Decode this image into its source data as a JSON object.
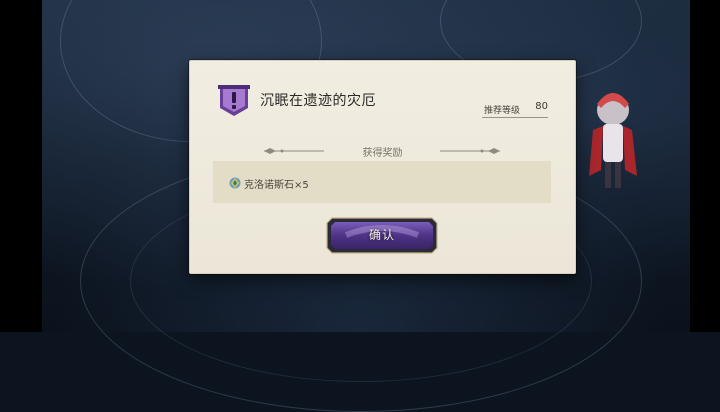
{
  "dialog": {
    "title": "沉眠在遗迹的灾厄",
    "quest_icon": "exclamation-shield-icon",
    "level_label": "推荐等级",
    "level_value": "80",
    "reward_heading": "获得奖励",
    "rewards": [
      {
        "icon": "crystal-stone-icon",
        "text": "克洛诺斯石×5"
      }
    ],
    "confirm_label": "确认"
  },
  "colors": {
    "dialog_bg": "#ede8da",
    "reward_panel": "#e3dcc6",
    "badge_purple": "#9b6fc4",
    "button_purple": "#5c3f96"
  }
}
